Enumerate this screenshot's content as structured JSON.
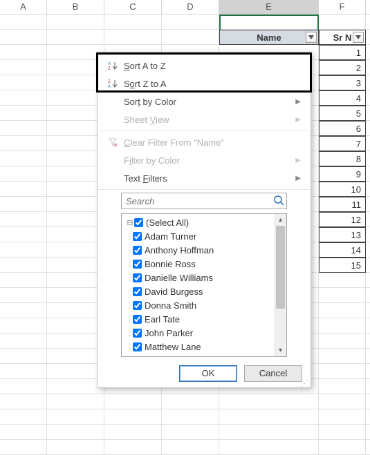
{
  "columns": [
    "A",
    "B",
    "C",
    "D",
    "E",
    "F"
  ],
  "table": {
    "header_e": "Name",
    "header_f": "Sr N",
    "rows": [
      "1",
      "2",
      "3",
      "4",
      "5",
      "6",
      "7",
      "8",
      "9",
      "10",
      "11",
      "12",
      "13",
      "14",
      "15"
    ]
  },
  "menu": {
    "sort_asc": "Sort A to Z",
    "sort_desc": "Sort Z to A",
    "sort_color": "Sort by Color",
    "sheet_view": "Sheet View",
    "clear_filter": "Clear Filter From \"Name\"",
    "filter_color": "Filter by Color",
    "text_filters": "Text Filters"
  },
  "search": {
    "placeholder": "Search"
  },
  "checklist": [
    "(Select All)",
    "Adam Turner",
    "Anthony Hoffman",
    "Bonnie Ross",
    "Danielle Williams",
    "David Burgess",
    "Donna Smith",
    "Earl Tate",
    "John Parker",
    "Matthew Lane"
  ],
  "buttons": {
    "ok": "OK",
    "cancel": "Cancel"
  }
}
